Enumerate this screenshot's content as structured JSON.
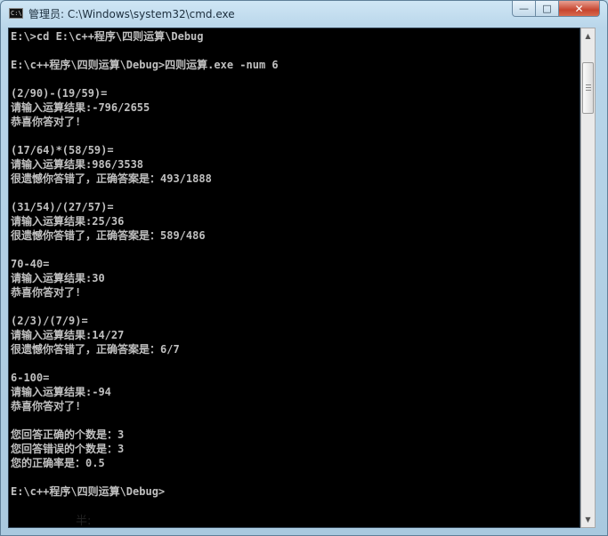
{
  "window": {
    "title": "管理员: C:\\Windows\\system32\\cmd.exe",
    "app_icon_text": "C:\\",
    "buttons": {
      "minimize": "—",
      "maximize": "□",
      "close": "✕"
    }
  },
  "console": {
    "lines": [
      "E:\\>cd E:\\c++程序\\四则运算\\Debug",
      "",
      "E:\\c++程序\\四则运算\\Debug>四则运算.exe -num 6",
      "",
      "(2/90)-(19/59)=",
      "请输入运算结果:-796/2655",
      "恭喜你答对了!",
      "",
      "(17/64)*(58/59)=",
      "请输入运算结果:986/3538",
      "很遗憾你答错了，正确答案是：493/1888",
      "",
      "(31/54)/(27/57)=",
      "请输入运算结果:25/36",
      "很遗憾你答错了，正确答案是：589/486",
      "",
      "70-40=",
      "请输入运算结果:30",
      "恭喜你答对了!",
      "",
      "(2/3)/(7/9)=",
      "请输入运算结果:14/27",
      "很遗憾你答错了，正确答案是：6/7",
      "",
      "6-100=",
      "请输入运算结果:-94",
      "恭喜你答对了!",
      "",
      "您回答正确的个数是：3",
      "您回答错误的个数是：3",
      "您的正确率是：0.5",
      "",
      "E:\\c++程序\\四则运算\\Debug>"
    ]
  },
  "ime": {
    "text": "半:"
  }
}
